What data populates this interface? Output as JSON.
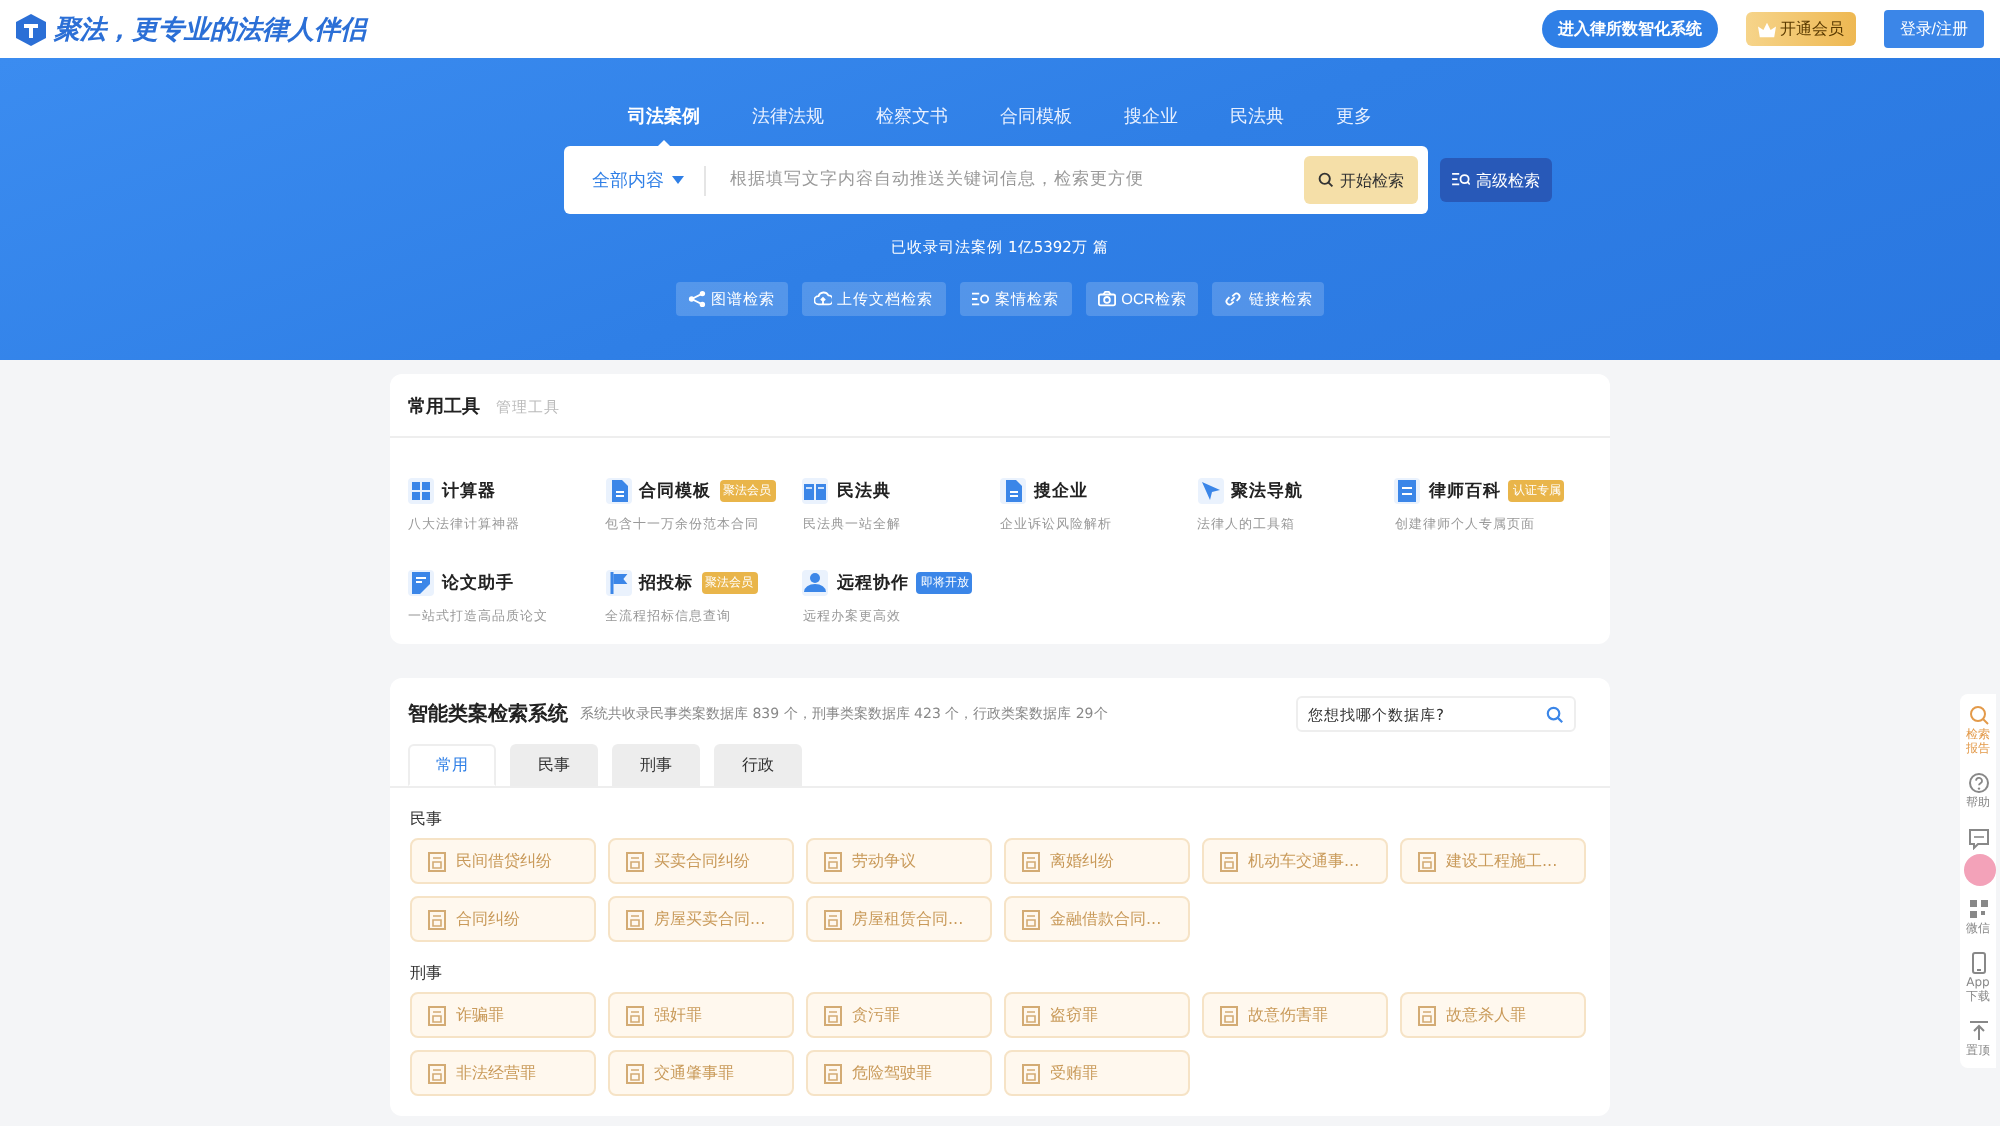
{
  "header": {
    "logo_text": "聚法，更专业的法律人伴侣",
    "firm_button": "进入律所数智化系统",
    "vip_button": "开通会员",
    "login_button": "登录/注册"
  },
  "search": {
    "tabs": [
      {
        "label": "司法案例",
        "selected": true
      },
      {
        "label": "法律法规",
        "selected": false
      },
      {
        "label": "检察文书",
        "selected": false
      },
      {
        "label": "合同模板",
        "selected": false
      },
      {
        "label": "搜企业",
        "selected": false
      },
      {
        "label": "民法典",
        "selected": false
      },
      {
        "label": "更多",
        "selected": false
      }
    ],
    "scope": "全部内容",
    "placeholder": "根据填写文字内容自动推送关键词信息，检索更方便",
    "submit": "开始检索",
    "advanced": "高级检索",
    "stats": "已收录司法案例 1亿5392万 篇",
    "modes": [
      {
        "kind": "graph",
        "label": "图谱检索"
      },
      {
        "kind": "upload",
        "label": "上传文档检索"
      },
      {
        "kind": "case",
        "label": "案情检索"
      },
      {
        "kind": "camera",
        "label": "OCR检索"
      },
      {
        "kind": "link",
        "label": "链接检索"
      }
    ]
  },
  "tools": {
    "title": "常用工具",
    "manage": "管理工具",
    "items": [
      {
        "kind": "calc",
        "name": "计算器",
        "desc": "八大法律计算神器"
      },
      {
        "kind": "doc",
        "name": "合同模板",
        "badge": {
          "text": "聚法会员",
          "color": "#e9b54a"
        },
        "desc": "包含十一万余份范本合同"
      },
      {
        "kind": "book",
        "name": "民法典",
        "desc": "民法典一站全解"
      },
      {
        "kind": "doc",
        "name": "搜企业",
        "desc": "企业诉讼风险解析"
      },
      {
        "kind": "cursor",
        "name": "聚法导航",
        "desc": "法律人的工具箱"
      },
      {
        "kind": "card",
        "name": "律师百科",
        "badge": {
          "text": "认证专属",
          "color": "#e9b54a"
        },
        "desc": "创建律师个人专属页面"
      },
      {
        "kind": "pen",
        "name": "论文助手",
        "desc": "一站式打造高品质论文"
      },
      {
        "kind": "flag",
        "name": "招投标",
        "badge": {
          "text": "聚法会员",
          "color": "#e9b54a"
        },
        "desc": "全流程招标信息查询"
      },
      {
        "kind": "people",
        "name": "远程协作",
        "badge": {
          "text": "即将开放",
          "color": "#3b86e8"
        },
        "desc": "远程办案更高效"
      }
    ]
  },
  "case_system": {
    "title": "智能类案检索系统",
    "desc": "系统共收录民事类案数据库 839 个，刑事类案数据库 423 个，行政类案数据库 29个",
    "search_placeholder": "您想找哪个数据库?",
    "tabs": [
      {
        "label": "常用",
        "selected": true
      },
      {
        "label": "民事",
        "selected": false
      },
      {
        "label": "刑事",
        "selected": false
      },
      {
        "label": "行政",
        "selected": false
      }
    ],
    "groups": [
      {
        "heading": "民事",
        "items": [
          "民间借贷纠纷",
          "买卖合同纠纷",
          "劳动争议",
          "离婚纠纷",
          "机动车交通事...",
          "建设工程施工...",
          "合同纠纷",
          "房屋买卖合同...",
          "房屋租赁合同...",
          "金融借款合同..."
        ]
      },
      {
        "heading": "刑事",
        "items": [
          "诈骗罪",
          "强奸罪",
          "贪污罪",
          "盗窃罪",
          "故意伤害罪",
          "故意杀人罪",
          "非法经营罪",
          "交通肇事罪",
          "危险驾驶罪",
          "受贿罪"
        ]
      }
    ]
  },
  "side_rail": [
    {
      "kind": "search",
      "label": "检索报告"
    },
    {
      "kind": "help",
      "label": "帮助"
    },
    {
      "kind": "chat"
    },
    {
      "kind": "qr",
      "label": "微信"
    },
    {
      "kind": "phone",
      "label": "App下载"
    },
    {
      "kind": "top",
      "label": "置顶"
    }
  ]
}
